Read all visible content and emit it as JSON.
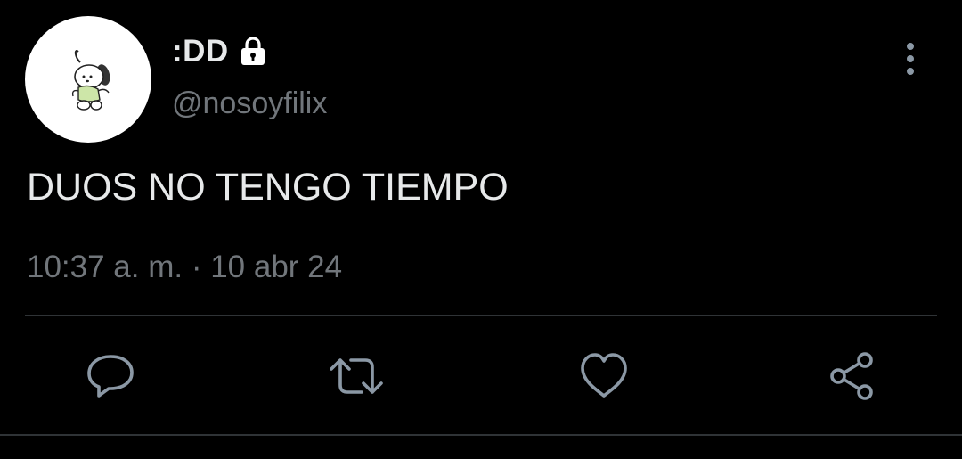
{
  "author": {
    "display_name": ":DD",
    "handle": "@nosoyfilix",
    "avatar_icon": "pochacco-avatar",
    "protected_icon": "lock-icon"
  },
  "tweet": {
    "text": "DUOS NO TENGO TIEMPO",
    "timestamp": "10:37 a. m. · 10 abr 24"
  },
  "menu": {
    "icon": "more-vertical-icon"
  },
  "actions": [
    {
      "name": "reply",
      "icon": "reply-icon"
    },
    {
      "name": "retweet",
      "icon": "retweet-icon"
    },
    {
      "name": "like",
      "icon": "heart-icon"
    },
    {
      "name": "share",
      "icon": "share-icon"
    }
  ],
  "colors": {
    "background": "#000000",
    "primary_text": "#e7e9ea",
    "secondary_text": "#71767b",
    "divider": "#2f3336",
    "icon": "#8b98a5"
  }
}
